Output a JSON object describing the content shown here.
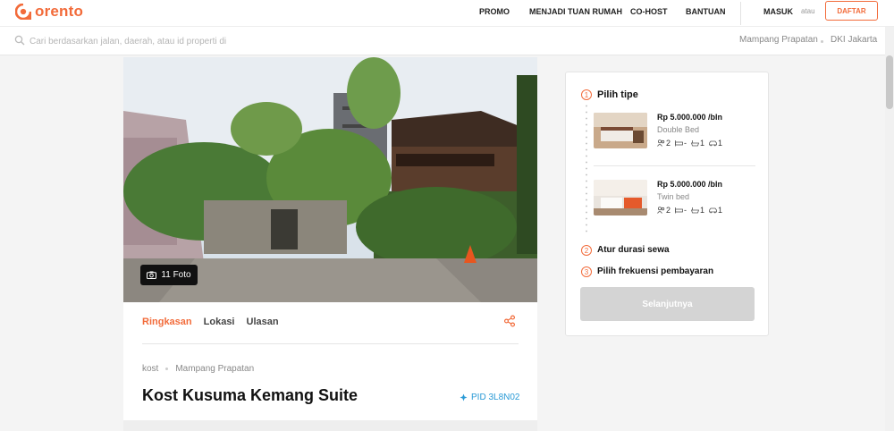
{
  "brand": {
    "name": "orento",
    "color": "#f26b3a"
  },
  "nav": {
    "promo": "PROMO",
    "host": "MENJADI TUAN RUMAH",
    "cohost": "CO-HOST",
    "help": "BANTUAN",
    "login": "MASUK",
    "or": "atau",
    "register": "DAFTAR"
  },
  "search": {
    "placeholder": "Cari berdasarkan jalan, daerah, atau id properti di"
  },
  "location": {
    "area": "Mampang Prapatan",
    "city": "DKI Jakarta"
  },
  "property": {
    "photo_count": "11 Foto",
    "tabs": [
      "Ringkasan",
      "Lokasi",
      "Ulasan"
    ],
    "active_tab": "Ringkasan",
    "type": "kost",
    "area": "Mampang Prapatan",
    "title": "Kost Kusuma Kemang Suite",
    "pid": "PID 3L8N02"
  },
  "booking": {
    "step1": {
      "num": "1",
      "label": "Pilih tipe"
    },
    "rooms": [
      {
        "price": "Rp 5.000.000 /bln",
        "type": "Double Bed",
        "amenities": [
          "2",
          "-",
          "1",
          "1"
        ]
      },
      {
        "price": "Rp 5.000.000 /bln",
        "type": "Twin bed",
        "amenities": [
          "2",
          "-",
          "1",
          "1"
        ]
      }
    ],
    "step2": {
      "num": "2",
      "label": "Atur durasi sewa"
    },
    "step3": {
      "num": "3",
      "label": "Pilih frekuensi pembayaran"
    },
    "next_label": "Selanjutnya"
  },
  "icons": {
    "logo": "orento-logo-icon",
    "search": "search-icon",
    "camera": "camera-icon",
    "share": "share-icon",
    "pid": "pin-icon"
  }
}
